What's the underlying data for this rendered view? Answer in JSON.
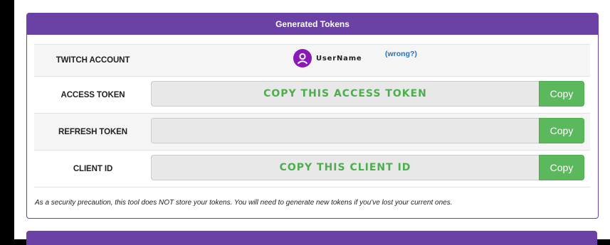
{
  "panel": {
    "title": "Generated Tokens"
  },
  "account": {
    "label": "TWITCH ACCOUNT",
    "username": "UserName",
    "wrong_link": "(wrong?)",
    "avatar_icon": "user-avatar-icon",
    "avatar_color": "#8a19b8"
  },
  "rows": [
    {
      "label": "ACCESS TOKEN",
      "field_text": "COPY THIS ACCESS TOKEN",
      "button": "Copy"
    },
    {
      "label": "REFRESH TOKEN",
      "field_text": "",
      "button": "Copy"
    },
    {
      "label": "CLIENT ID",
      "field_text": "COPY THIS CLIENT ID",
      "button": "Copy"
    }
  ],
  "note": "As a security precaution, this tool does NOT store your tokens. You will need to generate new tokens if you've lost your current ones.",
  "colors": {
    "header": "#6b41a6",
    "button": "#5cb85c",
    "field_text": "#4cae4c",
    "link": "#2c6fb0"
  }
}
